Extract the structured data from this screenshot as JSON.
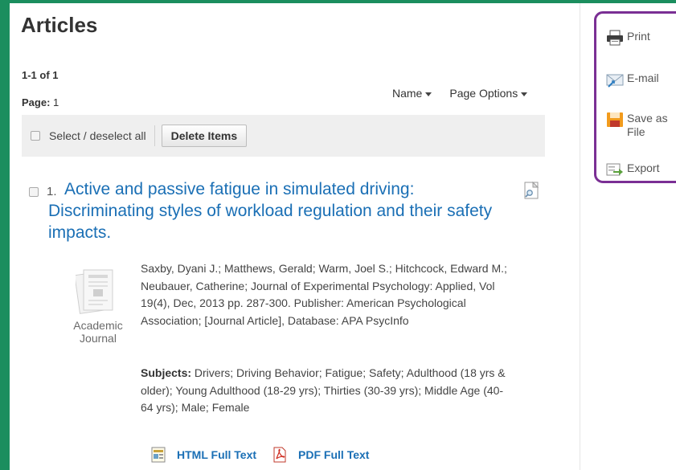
{
  "page": {
    "heading": "Articles",
    "result_count": "1-1 of 1",
    "page_label": "Page:",
    "page_number": "1"
  },
  "sort": {
    "name_label": "Name",
    "options_label": "Page Options"
  },
  "toolbar": {
    "select_all_label": "Select / deselect all",
    "delete_label": "Delete Items"
  },
  "result": {
    "number": "1.",
    "title": "Active and passive fatigue in simulated driving: Discriminating styles of workload regulation and their safety impacts.",
    "doc_type_line1": "Academic",
    "doc_type_line2": "Journal",
    "citation": "Saxby, Dyani J.; Matthews, Gerald; Warm, Joel S.; Hitchcock, Edward M.; Neubauer, Catherine; Journal of Experimental Psychology: Applied, Vol 19(4), Dec, 2013 pp. 287-300. Publisher: American Psychological Association; [Journal Article], Database: APA PsycInfo",
    "subjects_label": "Subjects:",
    "subjects": "Drivers; Driving Behavior; Fatigue; Safety; Adulthood (18 yrs & older); Young Adulthood (18-29 yrs); Thirties (30-39 yrs); Middle Age (40-64 yrs); Male; Female",
    "html_full_text": "HTML Full Text",
    "pdf_full_text": "PDF Full Text"
  },
  "tools": {
    "print": "Print",
    "email": "E-mail",
    "save_as_file_line1": "Save as",
    "save_as_file_line2": "File",
    "export": "Export"
  },
  "colors": {
    "background_green": "#1b8e5e",
    "link_blue": "#1a6fb5",
    "tools_border": "#7a2f94",
    "toolbar_bg": "#efefef"
  },
  "icons": [
    "preview-icon",
    "journal-icon",
    "html-full-text-icon",
    "pdf-icon",
    "print-icon",
    "email-icon",
    "save-icon",
    "export-icon"
  ]
}
